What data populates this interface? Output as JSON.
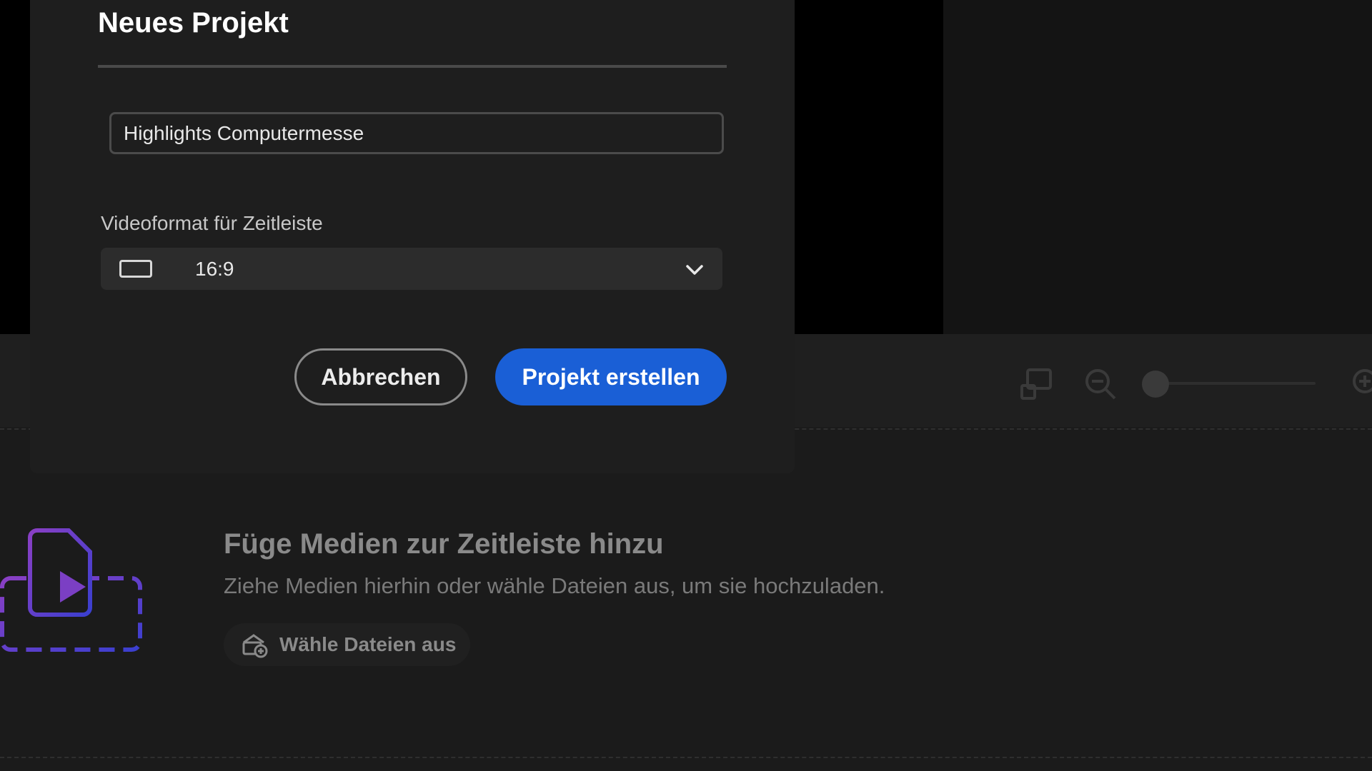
{
  "dialog": {
    "title": "Neues Projekt",
    "project_name_value": "Highlights Computermesse",
    "format_label": "Videoformat für Zeitleiste",
    "format_value": "16:9",
    "format_icon": "aspect-ratio-icon",
    "cancel_label": "Abbrechen",
    "create_label": "Projekt erstellen"
  },
  "toolbar": {
    "icons": [
      "fit-to-window-icon",
      "zoom-out-icon",
      "zoom-in-icon"
    ]
  },
  "timeline_empty": {
    "title": "Füge Medien zur Zeitleiste hinzu",
    "subtitle": "Ziehe Medien hierhin oder wähle Dateien aus, um sie hochzuladen.",
    "choose_files_label": "Wähle Dateien aus",
    "choose_files_icon": "upload-media-icon",
    "illustration_icon": "video-file-drop-icon"
  },
  "colors": {
    "accent": "#1a5fd6",
    "illustration_purple": "#7b3fc4",
    "illustration_blue": "#3b3fc8"
  }
}
